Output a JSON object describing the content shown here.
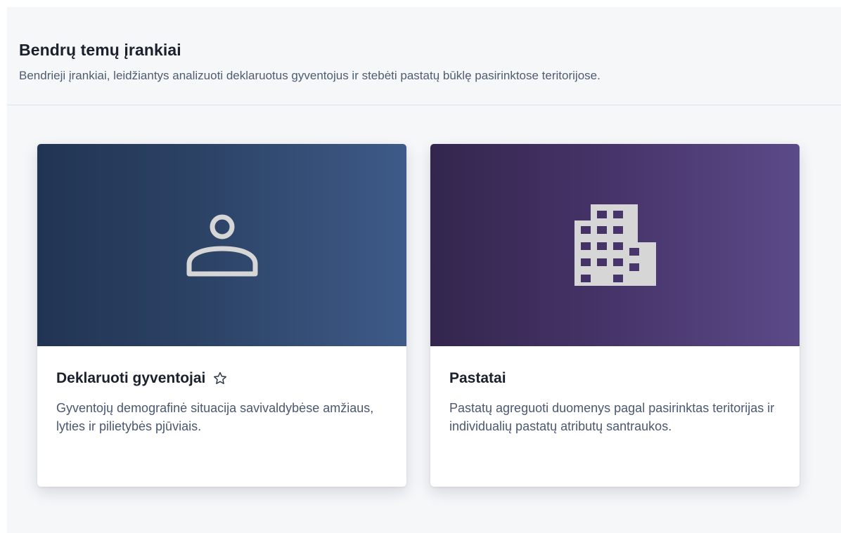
{
  "section": {
    "title": "Bendrų temų įrankiai",
    "description": "Bendrieji įrankiai, leidžiantys analizuoti deklaruotus gyventojus ir stebėti pastatų būklę pasirinktose teritorijose."
  },
  "cards": [
    {
      "title": "Deklaruoti gyventojai",
      "description": "Gyventojų demografinė situacija savivaldybėse amžiaus, lyties ir pilietybės pjūviais.",
      "icon": "person-icon",
      "favorite_icon": "star-outline-icon"
    },
    {
      "title": "Pastatai",
      "description": "Pastatų agreguoti duomenys pagal pasirinktas teritorijas ir individualių pastatų atributų santraukos.",
      "icon": "building-icon"
    }
  ],
  "colors": {
    "banner_blue_start": "#223453",
    "banner_blue_end": "#3e5a88",
    "banner_purple_start": "#33264d",
    "banner_purple_end": "#5b4a88",
    "icon_gray": "#d6d6d6"
  }
}
